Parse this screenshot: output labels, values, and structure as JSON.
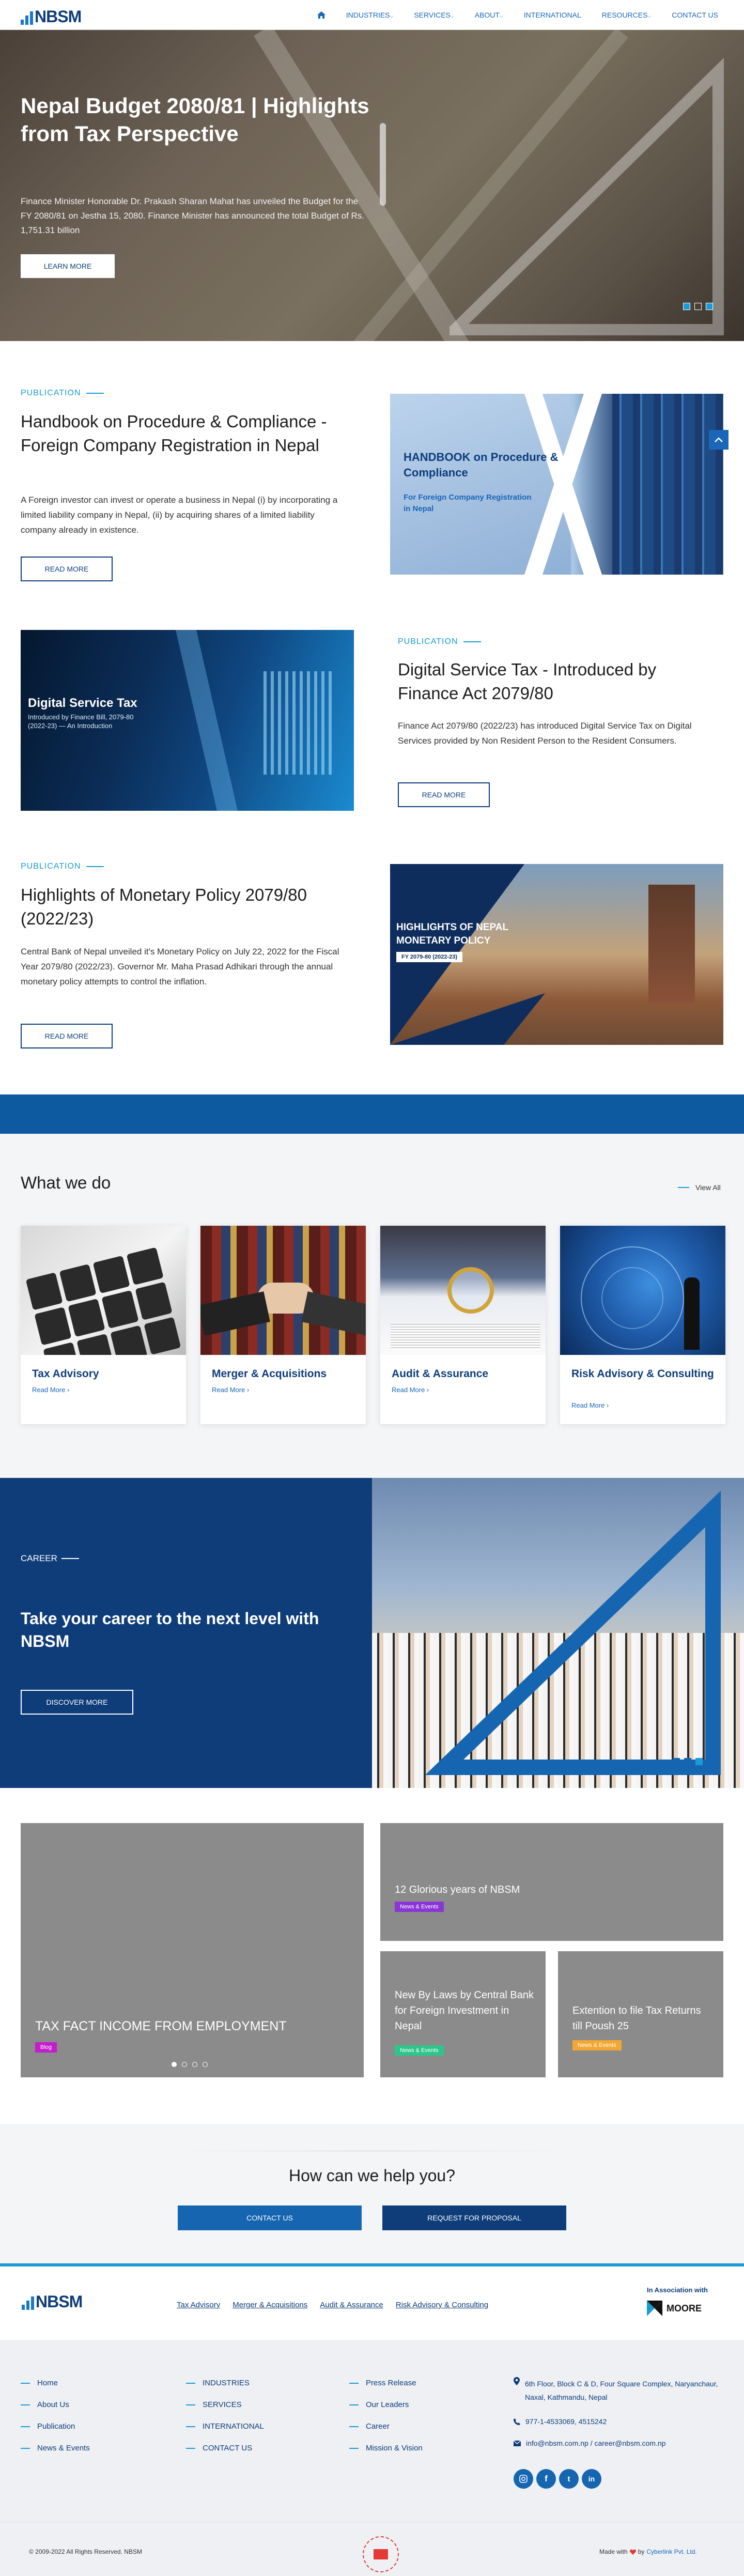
{
  "brand": {
    "name": "NBSM"
  },
  "nav": {
    "items": [
      "INDUSTRIES",
      "SERVICES",
      "ABOUT",
      "INTERNATIONAL",
      "RESOURCES",
      "CONTACT US"
    ],
    "has_dropdown": [
      true,
      true,
      true,
      false,
      true,
      false
    ]
  },
  "hero": {
    "title": "Nepal Budget 2080/81 | Highlights from Tax Perspective",
    "text": "Finance Minister Honorable Dr. Prakash Sharan Mahat has unveiled the Budget for the FY 2080/81 on Jestha 15, 2080. Finance Minister has announced the total Budget of Rs. 1,751.31 billion",
    "button": "LEARN MORE"
  },
  "publications": [
    {
      "tag": "PUBLICATION",
      "title": "Handbook on Procedure & Compliance - Foreign Company Registration in Nepal",
      "text": "A Foreign investor can invest or operate a business in Nepal (i) by incorporating a limited liability company in Nepal, (ii) by acquiring shares of a limited liability company already in existence.",
      "button": "READ MORE",
      "img_title": "HANDBOOK on Procedure & Compliance",
      "img_sub": "For Foreign Company Registration in Nepal"
    },
    {
      "tag": "PUBLICATION",
      "title": "Digital Service Tax - Introduced by Finance Act 2079/80",
      "text": "Finance Act 2079/80 (2022/23) has introduced Digital Service Tax on Digital Services provided by Non Resident Person to the Resident Consumers.",
      "button": "READ MORE",
      "img_title": "Digital Service Tax",
      "img_sub": "Introduced by Finance Bill, 2079-80 (2022-23) — An Introduction"
    },
    {
      "tag": "PUBLICATION",
      "title": "Highlights of Monetary Policy 2079/80 (2022/23)",
      "text": "Central Bank of Nepal unveiled it's Monetary Policy on July 22, 2022 for the Fiscal Year 2079/80 (2022/23). Governor Mr. Maha Prasad Adhikari through the annual monetary policy attempts to control the inflation.",
      "button": "READ MORE",
      "img_title": "HIGHLIGHTS OF NEPAL MONETARY POLICY",
      "img_sub": "FY 2079-80 (2022-23)"
    }
  ],
  "what_we_do": {
    "title": "What we do",
    "view_all": "View All",
    "read_more": "Read More",
    "cards": [
      {
        "title": "Tax Advisory"
      },
      {
        "title": "Merger & Acquisitions"
      },
      {
        "title": "Audit & Assurance"
      },
      {
        "title": "Risk Advisory & Consulting"
      }
    ]
  },
  "career": {
    "tag": "CAREER",
    "title": "Take your career to the next level with NBSM",
    "button": "DISCOVER MORE"
  },
  "news": {
    "big": {
      "title": "TAX FACT INCOME FROM EMPLOYMENT",
      "badge": "Blog"
    },
    "top": {
      "title": "12 Glorious years of NBSM",
      "badge": "News & Events"
    },
    "mid": {
      "title": "New By Laws by Central Bank for Foreign Investment in Nepal",
      "badge": "News & Events"
    },
    "right": {
      "title": "Extention to file Tax Returns till Poush 25",
      "badge": "News & Events"
    }
  },
  "help": {
    "title": "How can we help you?",
    "contact": "CONTACT US",
    "proposal": "REQUEST FOR PROPOSAL"
  },
  "footer": {
    "service_links": [
      "Tax Advisory",
      "Merger & Acquisitions",
      "Audit & Assurance",
      "Risk Advisory & Consulting"
    ],
    "assoc_label": "In Association with",
    "assoc_name": "MOORE",
    "col1": [
      "Home",
      "About Us",
      "Publication",
      "News & Events"
    ],
    "col2": [
      "INDUSTRIES",
      "SERVICES",
      "INTERNATIONAL",
      "CONTACT US"
    ],
    "col3": [
      "Press Release",
      "Our Leaders",
      "Career",
      "Mission & Vision"
    ],
    "address": "6th Floor, Block C & D, Four Square Complex, Naryanchaur, Naxal, Kathmandu, Nepal",
    "phone": "977-1-4533069, 4515242",
    "email": "info@nbsm.com.np / career@nbsm.com.np",
    "copyright": "© 2009-2022 All Rights Reserved. NBSM",
    "made_with": "Made with",
    "by": "by",
    "maker": "Cyberlink Pvt. Ltd.",
    "social": [
      "ig",
      "f",
      "t",
      "in"
    ]
  },
  "colors": {
    "navy": "#0e3d7a",
    "blue": "#1b9ad6",
    "band": "#0e5aa0"
  }
}
